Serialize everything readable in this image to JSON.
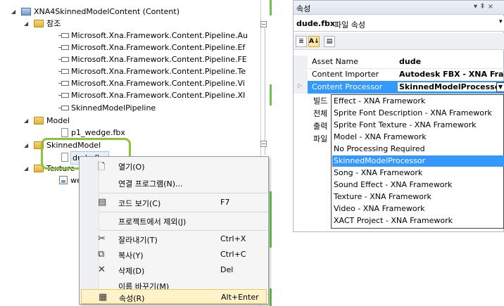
{
  "solution_tree": {
    "project": "XNA4SkinnedModelContent (Content)",
    "references_folder": "참조",
    "references": [
      "Microsoft.Xna.Framework.Content.Pipeline.Au",
      "Microsoft.Xna.Framework.Content.Pipeline.Ef",
      "Microsoft.Xna.Framework.Content.Pipeline.FE",
      "Microsoft.Xna.Framework.Content.Pipeline.Te",
      "Microsoft.Xna.Framework.Content.Pipeline.Vi",
      "Microsoft.Xna.Framework.Content.Pipeline.XI",
      "SkinnedModelPipeline"
    ],
    "model_folder": "Model",
    "model_file": "p1_wedge.fbx",
    "skinned_folder": "SkinnedModel",
    "skinned_file": "dude.fbx",
    "texture_folder": "Texture",
    "texture_file": "wedge"
  },
  "context_menu": {
    "items": [
      {
        "label": "열기(O)",
        "shortcut": "",
        "icon": "open-icon"
      },
      {
        "label": "연결 프로그램(N)...",
        "shortcut": "",
        "icon": ""
      },
      {
        "label": "코드 보기(C)",
        "shortcut": "F7",
        "icon": "code-icon"
      },
      {
        "label": "프로젝트에서 제외(J)",
        "shortcut": "",
        "icon": ""
      },
      {
        "label": "잘라내기(T)",
        "shortcut": "Ctrl+X",
        "icon": "cut-icon"
      },
      {
        "label": "복사(Y)",
        "shortcut": "Ctrl+C",
        "icon": "copy-icon"
      },
      {
        "label": "삭제(D)",
        "shortcut": "Del",
        "icon": "delete-icon"
      },
      {
        "label": "이름 바꾸기(M)",
        "shortcut": "",
        "icon": ""
      },
      {
        "label": "속성(R)",
        "shortcut": "Alt+Enter",
        "icon": "properties-icon"
      }
    ]
  },
  "properties": {
    "title": "속성",
    "title_controls": "▾ ⇞ ×",
    "object_name": "dude.fbx",
    "object_desc": "파일 속성",
    "rows": [
      {
        "name": "Asset Name",
        "value": "dude"
      },
      {
        "name": "Content Importer",
        "value": "Autodesk FBX - XNA Fram"
      },
      {
        "name": "Content Processor",
        "value": "SkinnedModelProcessor"
      }
    ],
    "cut_rows": [
      "빌드",
      "전체",
      "출력",
      "파일"
    ],
    "processor_options": [
      "Effect - XNA Framework",
      "Sprite Font Description - XNA Framework",
      "Sprite Font Texture - XNA Framework",
      "Model - XNA Framework",
      "No Processing Required",
      "SkinnedModelProcessor",
      "Song - XNA Framework",
      "Sound Effect - XNA Framework",
      "Texture - XNA Framework",
      "Video - XNA Framework",
      "XACT Project - XNA Framework"
    ],
    "selected_option": "SkinnedModelProcessor"
  },
  "colors": {
    "highlight": "#8ac43c",
    "selection": "#3399ff",
    "menu_hover": "#fdf2c8"
  }
}
